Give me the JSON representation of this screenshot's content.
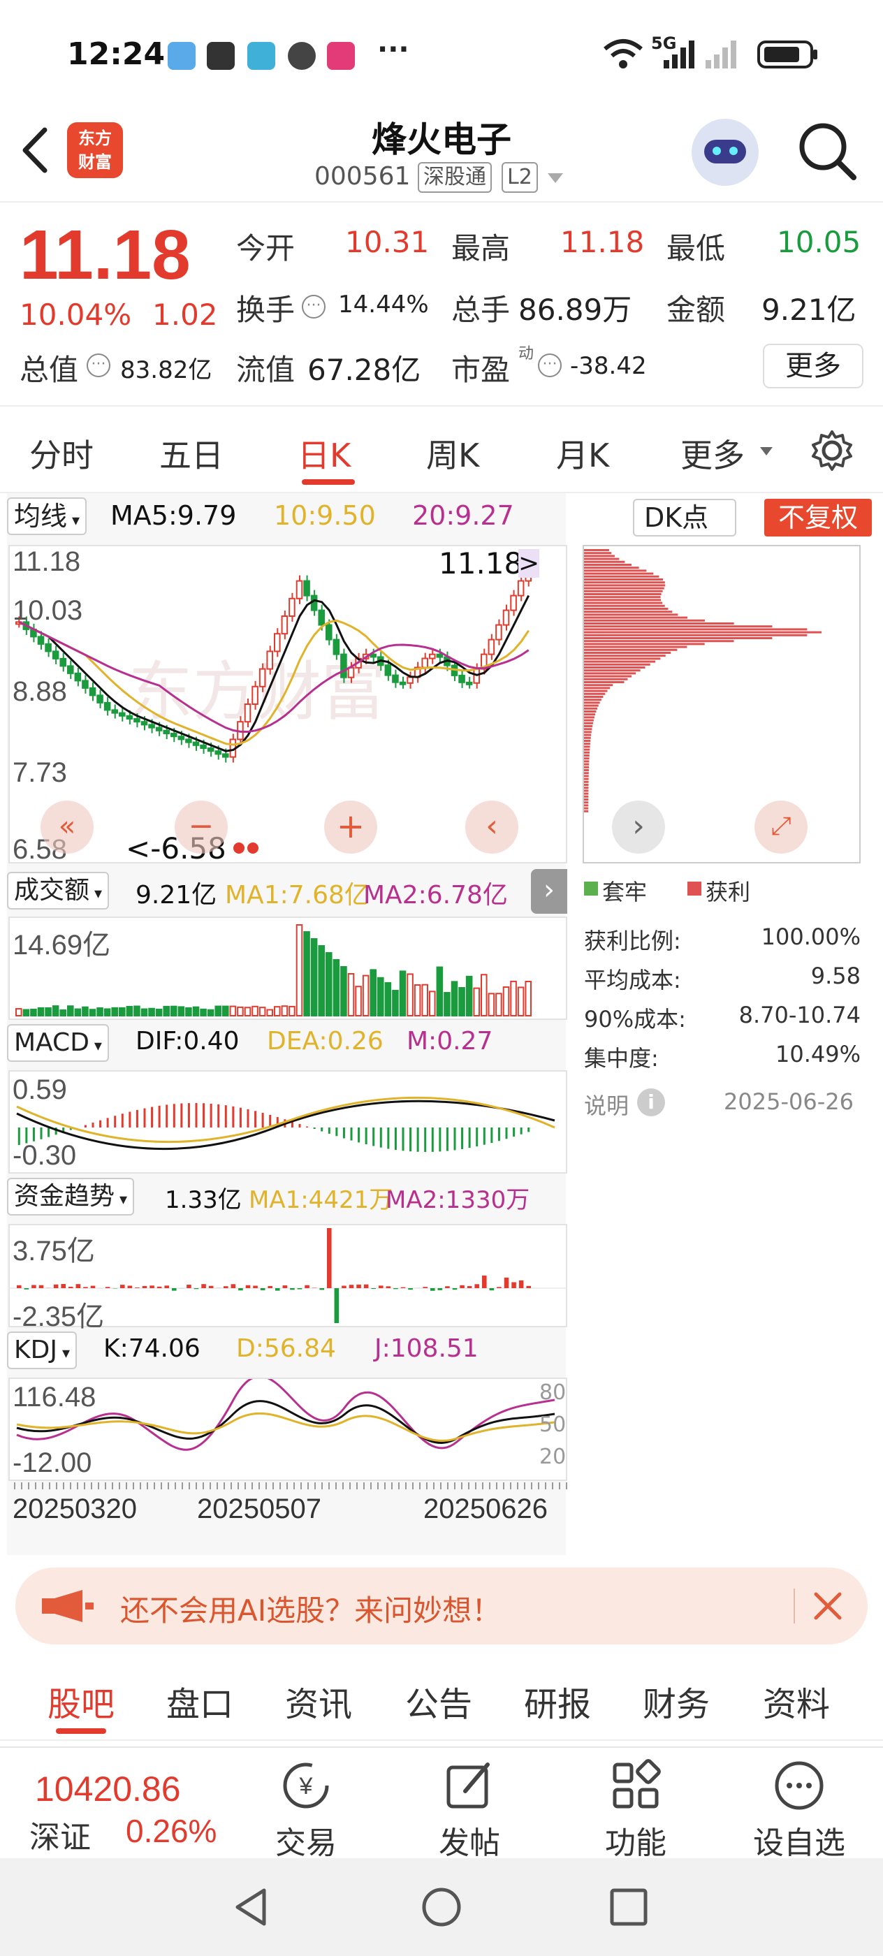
{
  "status_bar": {
    "time": "12:24",
    "more": "···",
    "network": "5G"
  },
  "header": {
    "logo_line1": "东方",
    "logo_line2": "财富",
    "stock_name": "烽火电子",
    "stock_code": "000561",
    "tag_connect": "深股通",
    "tag_level": "L2"
  },
  "quote": {
    "price": "11.18",
    "change_pct": "10.04%",
    "change_amt": "1.02",
    "open_label": "今开",
    "open_value": "10.31",
    "high_label": "最高",
    "high_value": "11.18",
    "low_label": "最低",
    "low_value": "10.05",
    "turnover_label": "换手",
    "turnover_value": "14.44%",
    "volume_label": "总手",
    "volume_value": "86.89万",
    "amount_label": "金额",
    "amount_value": "9.21亿",
    "mktcap_label": "总值",
    "mktcap_value": "83.82亿",
    "float_label": "流值",
    "float_value": "67.28亿",
    "pe_label": "市盈",
    "pe_sup": "动",
    "pe_value": "-38.42",
    "more_label": "更多"
  },
  "period_tabs": [
    {
      "label": "分时"
    },
    {
      "label": "五日"
    },
    {
      "label": "日K"
    },
    {
      "label": "周K"
    },
    {
      "label": "月K"
    },
    {
      "label": "更多"
    }
  ],
  "kline": {
    "ma_selector": "均线",
    "ma5": "MA5:9.79",
    "ma10": "10:9.50",
    "ma20": "20:9.27",
    "dk_label": "DK点",
    "fq_label": "不复权",
    "price_ticks": [
      "11.18",
      "10.03",
      "8.88",
      "7.73",
      "6.58"
    ],
    "high_marker": "11.18",
    "low_marker": "<-6.58",
    "watermark": "东方财富"
  },
  "volume": {
    "name": "成交额",
    "value": "9.21亿",
    "ma1": "MA1:7.68亿",
    "ma2": "MA2:6.78亿",
    "tick": "14.69亿"
  },
  "macd": {
    "name": "MACD",
    "dif": "DIF:0.40",
    "dea": "DEA:0.26",
    "m": "M:0.27",
    "tick_top": "0.59",
    "tick_bottom": "-0.30"
  },
  "fund": {
    "name": "资金趋势",
    "value": "1.33亿",
    "ma1": "MA1:4421万",
    "ma2": "MA2:1330万",
    "tick_top": "3.75亿",
    "tick_bottom": "-2.35亿"
  },
  "kdj": {
    "name": "KDJ",
    "k": "K:74.06",
    "d": "D:56.84",
    "j": "J:108.51",
    "tick_top": "116.48",
    "tick_bottom": "-12.00",
    "right_ticks": [
      "80",
      "50",
      "20"
    ]
  },
  "dates": [
    "20250320",
    "20250507",
    "20250626"
  ],
  "chips": {
    "legend_trapped": "套牢",
    "legend_profit": "获利",
    "stats": [
      {
        "label": "获利比例:",
        "value": "100.00%"
      },
      {
        "label": "平均成本:",
        "value": "9.58"
      },
      {
        "label": "90%成本:",
        "value": "8.70-10.74"
      },
      {
        "label": "集中度:",
        "value": "10.49%"
      }
    ],
    "note_label": "说明",
    "date": "2025-06-26"
  },
  "banner": {
    "text": "还不会用AI选股？来问妙想！"
  },
  "bottom_tabs": [
    {
      "label": "股吧"
    },
    {
      "label": "盘口"
    },
    {
      "label": "资讯"
    },
    {
      "label": "公告"
    },
    {
      "label": "研报"
    },
    {
      "label": "财务"
    },
    {
      "label": "资料"
    }
  ],
  "footer": {
    "index_value": "10420.86",
    "index_name": "深证",
    "index_change": "0.26%",
    "trade": "交易",
    "post": "发帖",
    "function": "功能",
    "watchlist": "设自选"
  },
  "colors": {
    "up": "#e23b2e",
    "down": "#1a9b3e",
    "ma5": "#111111",
    "ma10": "#e0b32a",
    "ma20": "#b8308f",
    "brand": "#e8482e"
  }
}
